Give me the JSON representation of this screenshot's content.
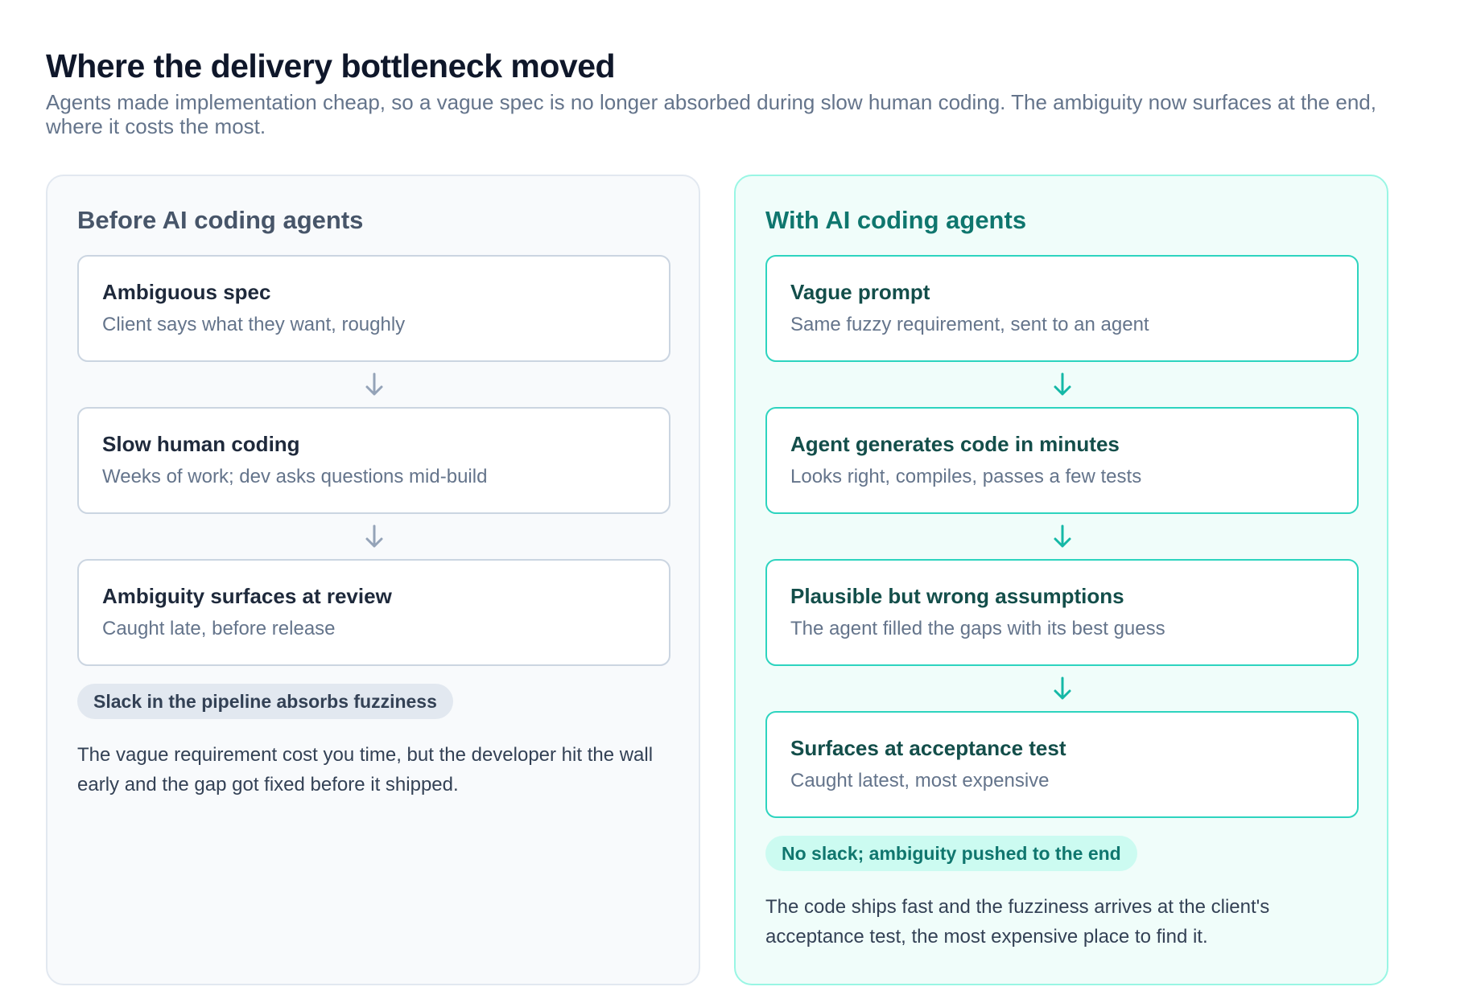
{
  "title": "Where the delivery bottleneck moved",
  "subtitle": "Agents made implementation cheap, so a vague spec is no longer absorbed during slow human coding. The ambiguity now surfaces at the end, where it costs the most.",
  "before": {
    "heading": "Before AI coding agents",
    "steps": [
      {
        "title": "Ambiguous spec",
        "desc": "Client says what they want, roughly"
      },
      {
        "title": "Slow human coding",
        "desc": "Weeks of work; dev asks questions mid-build"
      },
      {
        "title": "Ambiguity surfaces at review",
        "desc": "Caught late, before release"
      }
    ],
    "tag": "Slack in the pipeline absorbs fuzziness",
    "note": "The vague requirement cost you time, but the developer hit the wall early and the gap got fixed before it shipped."
  },
  "after": {
    "heading": "With AI coding agents",
    "steps": [
      {
        "title": "Vague prompt",
        "desc": "Same fuzzy requirement, sent to an agent"
      },
      {
        "title": "Agent generates code in minutes",
        "desc": "Looks right, compiles, passes a few tests"
      },
      {
        "title": "Plausible but wrong assumptions",
        "desc": "The agent filled the gaps with its best guess"
      },
      {
        "title": "Surfaces at acceptance test",
        "desc": "Caught latest, most expensive"
      }
    ],
    "tag": "No slack; ambiguity pushed to the end",
    "note": "The code ships fast and the fuzziness arrives at the client's acceptance test, the most expensive place to find it."
  },
  "colors": {
    "before_arrow": "#94a3b8",
    "after_arrow": "#14b8a6"
  }
}
